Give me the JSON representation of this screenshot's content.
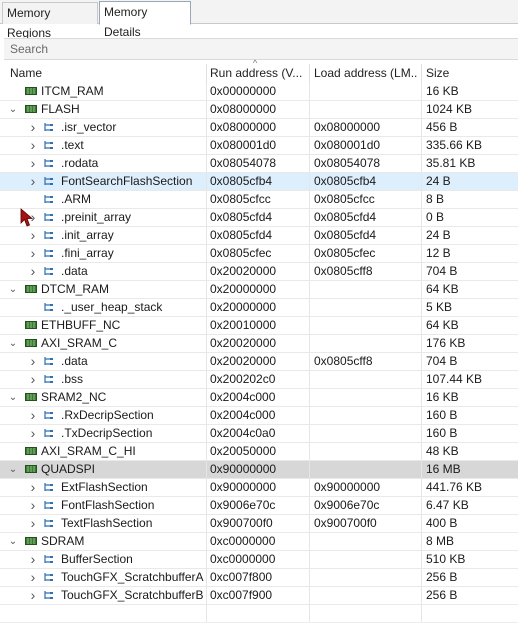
{
  "tabs": [
    {
      "label": "Memory Regions",
      "active": false
    },
    {
      "label": "Memory Details",
      "active": true
    }
  ],
  "search": {
    "placeholder": "Search"
  },
  "columns": [
    "Name",
    "Run address (V...",
    "Load address (LM...",
    "Size"
  ],
  "colors": {
    "region_icon": "#3b7a35",
    "section_icon": "#2f6fb2",
    "selected_row": "#ddeefc",
    "highlight_row": "#d7d7d7"
  },
  "rows": [
    {
      "name": "ITCM_RAM",
      "run": "0x00000000",
      "load": "",
      "size": "16 KB",
      "kind": "region",
      "chevron": "",
      "depth": 0
    },
    {
      "name": "FLASH",
      "run": "0x08000000",
      "load": "",
      "size": "1024 KB",
      "kind": "region",
      "chevron": "down",
      "depth": 0
    },
    {
      "name": ".isr_vector",
      "run": "0x08000000",
      "load": "0x08000000",
      "size": "456 B",
      "kind": "section",
      "chevron": "right",
      "depth": 1
    },
    {
      "name": ".text",
      "run": "0x080001d0",
      "load": "0x080001d0",
      "size": "335.66 KB",
      "kind": "section",
      "chevron": "right",
      "depth": 1
    },
    {
      "name": ".rodata",
      "run": "0x08054078",
      "load": "0x08054078",
      "size": "35.81 KB",
      "kind": "section",
      "chevron": "right",
      "depth": 1
    },
    {
      "name": "FontSearchFlashSection",
      "run": "0x0805cfb4",
      "load": "0x0805cfb4",
      "size": "24 B",
      "kind": "section",
      "chevron": "right",
      "depth": 1,
      "state": "selected"
    },
    {
      "name": ".ARM",
      "run": "0x0805cfcc",
      "load": "0x0805cfcc",
      "size": "8 B",
      "kind": "section",
      "chevron": "",
      "depth": 1
    },
    {
      "name": ".preinit_array",
      "run": "0x0805cfd4",
      "load": "0x0805cfd4",
      "size": "0 B",
      "kind": "section",
      "chevron": "right",
      "depth": 1
    },
    {
      "name": ".init_array",
      "run": "0x0805cfd4",
      "load": "0x0805cfd4",
      "size": "24 B",
      "kind": "section",
      "chevron": "right",
      "depth": 1
    },
    {
      "name": ".fini_array",
      "run": "0x0805cfec",
      "load": "0x0805cfec",
      "size": "12 B",
      "kind": "section",
      "chevron": "right",
      "depth": 1
    },
    {
      "name": ".data",
      "run": "0x20020000",
      "load": "0x0805cff8",
      "size": "704 B",
      "kind": "section",
      "chevron": "right",
      "depth": 1
    },
    {
      "name": "DTCM_RAM",
      "run": "0x20000000",
      "load": "",
      "size": "64 KB",
      "kind": "region",
      "chevron": "down",
      "depth": 0
    },
    {
      "name": "._user_heap_stack",
      "run": "0x20000000",
      "load": "",
      "size": "5 KB",
      "kind": "section",
      "chevron": "",
      "depth": 1
    },
    {
      "name": "ETHBUFF_NC",
      "run": "0x20010000",
      "load": "",
      "size": "64 KB",
      "kind": "region",
      "chevron": "",
      "depth": 0
    },
    {
      "name": "AXI_SRAM_C",
      "run": "0x20020000",
      "load": "",
      "size": "176 KB",
      "kind": "region",
      "chevron": "down",
      "depth": 0
    },
    {
      "name": ".data",
      "run": "0x20020000",
      "load": "0x0805cff8",
      "size": "704 B",
      "kind": "section",
      "chevron": "right",
      "depth": 1
    },
    {
      "name": ".bss",
      "run": "0x200202c0",
      "load": "",
      "size": "107.44 KB",
      "kind": "section",
      "chevron": "right",
      "depth": 1
    },
    {
      "name": "SRAM2_NC",
      "run": "0x2004c000",
      "load": "",
      "size": "16 KB",
      "kind": "region",
      "chevron": "down",
      "depth": 0
    },
    {
      "name": ".RxDecripSection",
      "run": "0x2004c000",
      "load": "",
      "size": "160 B",
      "kind": "section",
      "chevron": "right",
      "depth": 1
    },
    {
      "name": ".TxDecripSection",
      "run": "0x2004c0a0",
      "load": "",
      "size": "160 B",
      "kind": "section",
      "chevron": "right",
      "depth": 1
    },
    {
      "name": "AXI_SRAM_C_HI",
      "run": "0x20050000",
      "load": "",
      "size": "48 KB",
      "kind": "region",
      "chevron": "",
      "depth": 0
    },
    {
      "name": "QUADSPI",
      "run": "0x90000000",
      "load": "",
      "size": "16 MB",
      "kind": "region",
      "chevron": "down",
      "depth": 0,
      "state": "highlight"
    },
    {
      "name": "ExtFlashSection",
      "run": "0x90000000",
      "load": "0x90000000",
      "size": "441.76 KB",
      "kind": "section",
      "chevron": "right",
      "depth": 1
    },
    {
      "name": "FontFlashSection",
      "run": "0x9006e70c",
      "load": "0x9006e70c",
      "size": "6.47 KB",
      "kind": "section",
      "chevron": "right",
      "depth": 1
    },
    {
      "name": "TextFlashSection",
      "run": "0x900700f0",
      "load": "0x900700f0",
      "size": "400 B",
      "kind": "section",
      "chevron": "right",
      "depth": 1
    },
    {
      "name": "SDRAM",
      "run": "0xc0000000",
      "load": "",
      "size": "8 MB",
      "kind": "region",
      "chevron": "down",
      "depth": 0
    },
    {
      "name": "BufferSection",
      "run": "0xc0000000",
      "load": "",
      "size": "510 KB",
      "kind": "section",
      "chevron": "right",
      "depth": 1
    },
    {
      "name": "TouchGFX_ScratchbufferA",
      "run": "0xc007f800",
      "load": "",
      "size": "256 B",
      "kind": "section",
      "chevron": "right",
      "depth": 1
    },
    {
      "name": "TouchGFX_ScratchbufferB",
      "run": "0xc007f900",
      "load": "",
      "size": "256 B",
      "kind": "section",
      "chevron": "right",
      "depth": 1
    }
  ]
}
